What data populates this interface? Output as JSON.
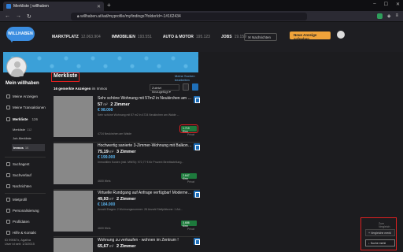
{
  "browser": {
    "tab_title": "Merkliste | willhaben",
    "url": "willhaben.at/iad/myprofile/myfindings?folderId=-1#162434",
    "icons": [
      "willhaben-favicon",
      "close-icon",
      "plus-icon",
      "back-icon",
      "forward-icon",
      "reload-icon",
      "lock-icon",
      "shield-icon",
      "menu-icon"
    ]
  },
  "header": {
    "logo": "WILLHABEN",
    "nav": [
      {
        "label": "MARKTPLATZ",
        "count": "12.063.904"
      },
      {
        "label": "IMMOBILIEN",
        "count": "193.551"
      },
      {
        "label": "AUTO & MOTOR",
        "count": "195.123"
      },
      {
        "label": "JOBS",
        "count": "19.159"
      }
    ],
    "search_label": "Nachrichten",
    "post_label": "Neue Anzeige aufgeben"
  },
  "profile": {
    "name": "Mein willhaben"
  },
  "sidebar": {
    "items": [
      {
        "label": "Meine Anzeigen",
        "count": ""
      },
      {
        "label": "Meine Transaktionen",
        "count": ""
      },
      {
        "label": "Merkliste",
        "count": "126"
      },
      {
        "label": "Suchagent",
        "count": ""
      },
      {
        "label": "Suchverlauf",
        "count": ""
      },
      {
        "label": "Nachrichten",
        "count": ""
      },
      {
        "label": "Mietprofil",
        "count": ""
      },
      {
        "label": "Personalisierung",
        "count": ""
      },
      {
        "label": "Profildaten",
        "count": ""
      },
      {
        "label": "Hilfe & Kontakt",
        "count": ""
      }
    ],
    "subs": [
      {
        "label": "Merkliste",
        "count": "112"
      },
      {
        "label": "Job-Merkliste",
        "count": ""
      },
      {
        "label": "Immos",
        "count": "16"
      }
    ],
    "account_line1": "ID 99067x, Agatha",
    "account_line2": "User id seit: 1/3/2015"
  },
  "main": {
    "title": "Merkliste",
    "saved_searches": "Meine Suchen bearbeiten",
    "count_prefix": "16 gemerkte Anzeigen",
    "count_suffix": "im Immos",
    "sort_label": "Zuletzt hinzugefügt"
  },
  "listings": [
    {
      "title": "Sehr schöne Wohnung mit 57m2 in Neukirchen am Walde",
      "area": "57",
      "unit": "m²",
      "rooms": "2 Zimmer",
      "price": "€ 98.000",
      "desc": "Sehr schöne Wohnung mit 57 m2 in 4724 Neukirchen am Walde ...",
      "location": "4724 Neukirchen am Walde",
      "badge": "1.719 €/m²",
      "badge_label": "Privat"
    },
    {
      "title": "Hochwertig sanierte 3-Zimmer-Wohnung mit Balkon und ...",
      "area": "75,19",
      "unit": "m²",
      "rooms": "3 Zimmer",
      "price": "€ 199.000",
      "desc": "Immobilien Kosten (inkl. MWSt): 972,77 € für Prozent Bereitsstellung...",
      "location": "4600 Wels",
      "badge": "2.647 €/m²",
      "badge_label": "Privat"
    },
    {
      "title": "Virtuelle Rundgang auf Anfrage verfügbar! Modernes Wo...",
      "area": "49,93",
      "unit": "m²",
      "rooms": "2 Zimmer",
      "price": "€ 184.000",
      "desc": "Anzahl Etagen: 2 Wohnungsnummer: 28 Anzahl Stellplätzone: 1 Anl...",
      "location": "4600 Wels",
      "badge": "3.686 €/m²",
      "badge_label": "Privat"
    },
    {
      "title": "Wohnung zu verkaufen - wohnen im Zentrum !",
      "area": "65,67",
      "unit": "m²",
      "rooms": "2 Zimmer",
      "price": "",
      "desc": "",
      "location": "",
      "badge": "",
      "badge_label": ""
    }
  ],
  "cookie_panel": {
    "title": "Zum Vergleich",
    "btn1": "+ Vergleiche merkl",
    "btn2": "↓ Suche merkl"
  }
}
